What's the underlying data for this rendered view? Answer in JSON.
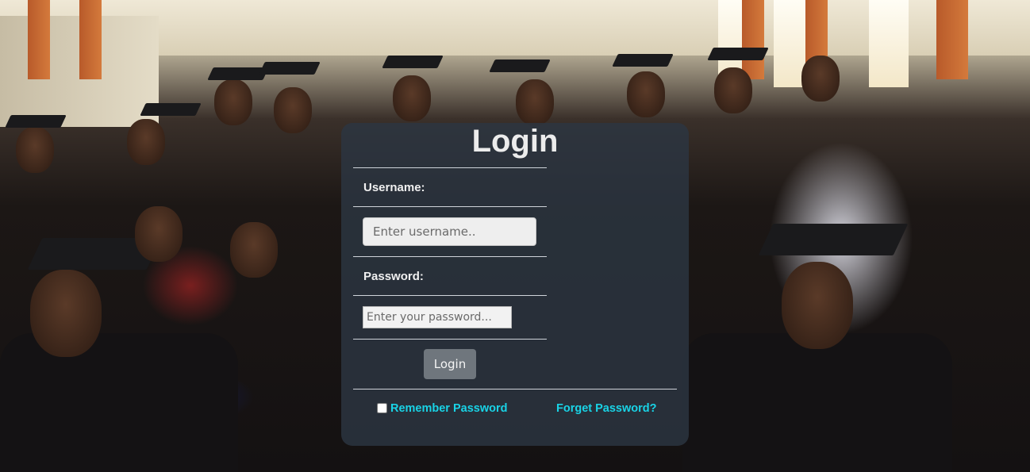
{
  "login": {
    "title": "Login",
    "username_label": "Username:",
    "username_placeholder": "Enter username..",
    "password_label": "Password:",
    "password_placeholder": "Enter your password...",
    "submit_label": "Login",
    "remember_label": "Remember Password",
    "remember_checked": false,
    "forget_label": "Forget Password?"
  },
  "colors": {
    "panel": "#2c3642",
    "link": "#19d3e6",
    "button": "#6f767d"
  }
}
